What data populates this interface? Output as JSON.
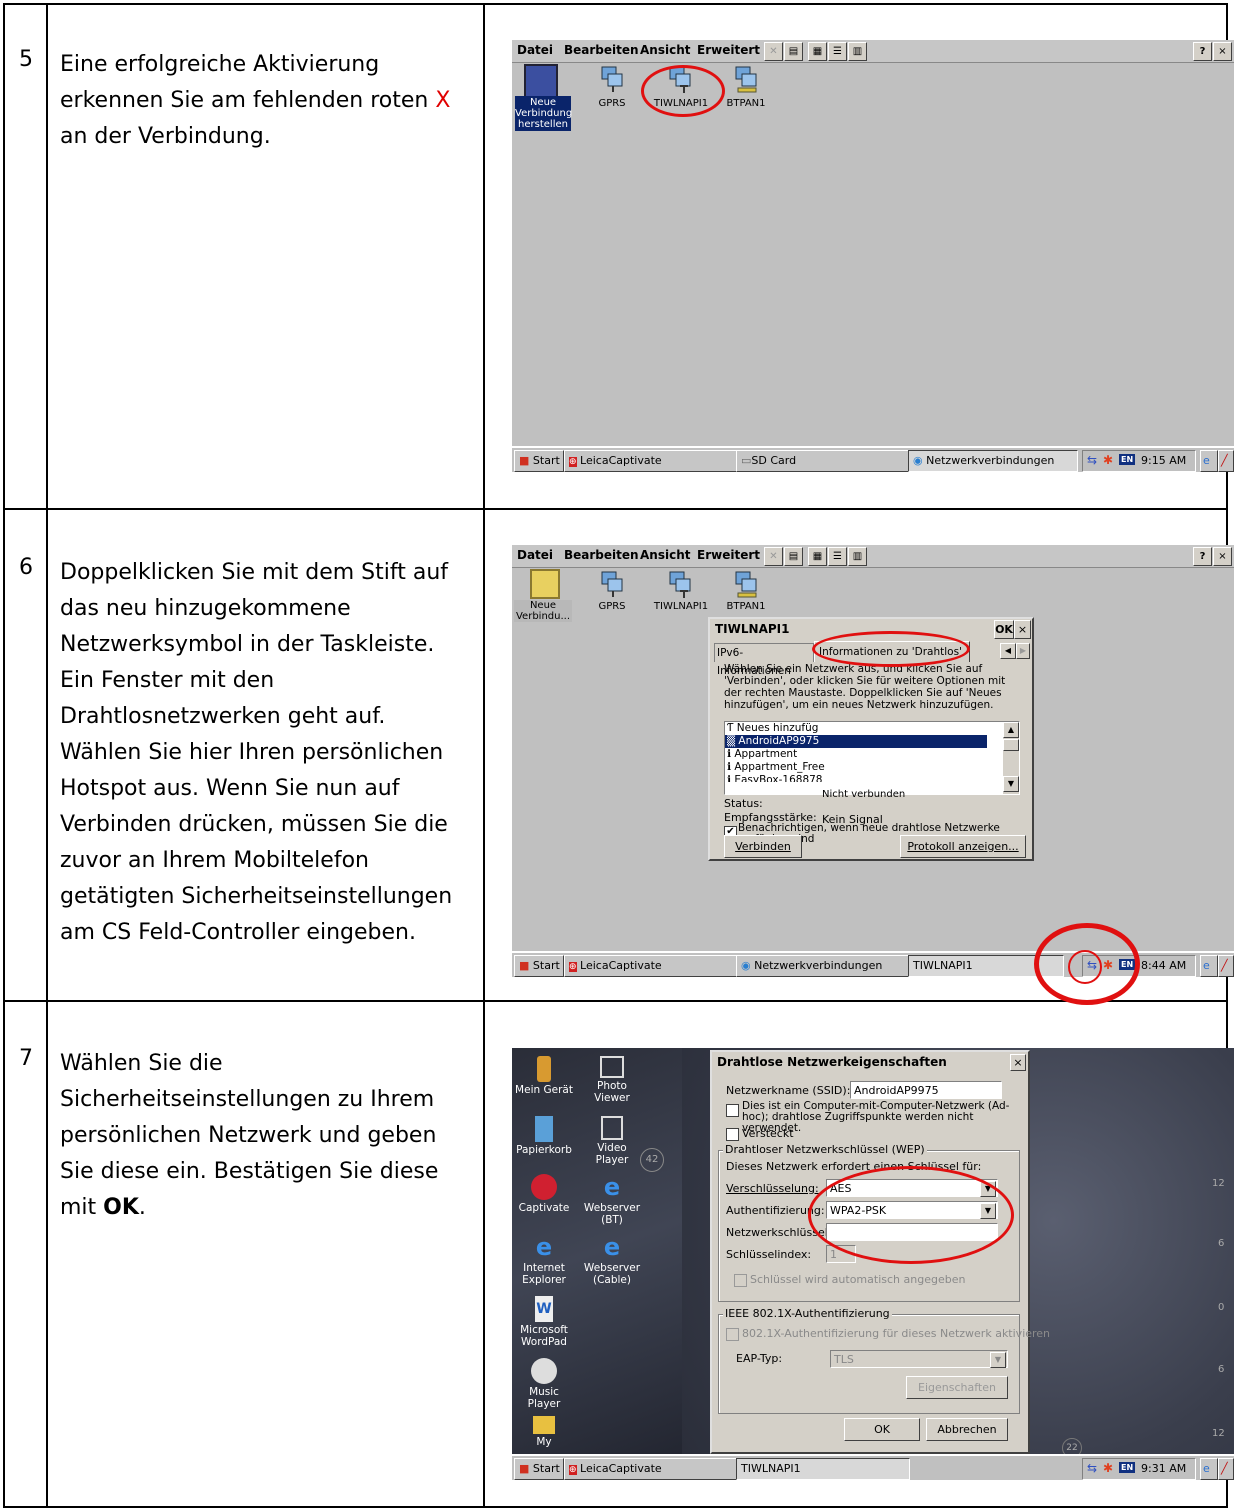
{
  "steps": [
    {
      "number": "5",
      "text_before": "Eine erfolgreiche Aktivierung erkennen Sie am fehlenden roten ",
      "text_highlight": "X",
      "text_after": " an der Verbindung.",
      "screenshot": {
        "menu": [
          "Datei",
          "Bearbeiten",
          "Ansicht",
          "Erweitert"
        ],
        "help": "?",
        "close": "×",
        "icons": [
          {
            "label": "Neue Verbindung herstellen",
            "selected": true
          },
          {
            "label": "GPRS"
          },
          {
            "label": "TIWLNAPI1"
          },
          {
            "label": "BTPAN1"
          }
        ],
        "taskbar": {
          "start": "Start",
          "buttons": [
            "LeicaCaptivate",
            "SD Card",
            "Netzwerkverbindungen"
          ],
          "clock": "9:15 AM",
          "lang": "EN"
        }
      }
    },
    {
      "number": "6",
      "text": "Doppelklicken Sie mit dem Stift auf das neu hinzugekommene Netzwerksymbol in der Taskleiste. Ein Fenster mit den Drahtlosnetzwerken geht auf. Wählen Sie hier Ihren persönlichen Hotspot aus. Wenn Sie nun auf Verbinden drücken, müssen Sie die zuvor an Ihrem Mobiltelefon getätigten Sicherheitseinstellungen am CS Feld-Controller eingeben.",
      "screenshot": {
        "menu": [
          "Datei",
          "Bearbeiten",
          "Ansicht",
          "Erweitert"
        ],
        "help": "?",
        "close": "×",
        "icons": [
          {
            "label": "Neue Verbindu..."
          },
          {
            "label": "GPRS"
          },
          {
            "label": "TIWLNAPI1"
          },
          {
            "label": "BTPAN1"
          }
        ],
        "dialog": {
          "title": "TIWLNAPI1",
          "ok": "OK",
          "close": "×",
          "tabs": [
            "IPv6-Informationen",
            "Informationen zu 'Drahtlos'"
          ],
          "instructions": "Wählen Sie ein Netzwerk aus, und klicken Sie auf 'Verbinden', oder klicken Sie für weitere Optionen mit der rechten Maustaste. Doppelklicken Sie auf 'Neues hinzufügen', um ein neues Netzwerk hinzuzufügen.",
          "networks": [
            "Neues hinzufüg",
            "AndroidAP9975",
            "Appartment",
            "Appartment_Free",
            "EasyBox-168878"
          ],
          "selected_network": "AndroidAP9975",
          "overlap_text": "Nicht verbunden",
          "status_label": "Status:",
          "signal_label": "Empfangsstärke:",
          "signal_value": "Kein Signal",
          "notify_text": "Benachrichtigen, wenn neue drahtlose Netzwerke verfügbar sind",
          "connect": "Verbinden",
          "log": "Protokoll anzeigen..."
        },
        "taskbar": {
          "start": "Start",
          "buttons": [
            "LeicaCaptivate",
            "Netzwerkverbindungen",
            "TIWLNAPI1"
          ],
          "clock": "8:44 AM",
          "lang": "EN"
        }
      }
    },
    {
      "number": "7",
      "text_before": "Wählen Sie die Sicherheitseinstellungen zu Ihrem persönlichen Netzwerk und geben Sie diese ein. Bestätigen Sie diese mit ",
      "text_bold": "OK",
      "text_after": ".",
      "screenshot": {
        "desktop_icons": [
          "Mein Gerät",
          "Photo Viewer",
          "Papierkorb",
          "Video Player",
          "Captivate",
          "Webserver (BT)",
          "Internet Explorer",
          "Webserver (Cable)",
          "Microsoft WordPad",
          "Music Player",
          "My"
        ],
        "dial_numbers": [
          "42",
          "12",
          "6",
          "0",
          "6",
          "12",
          "22"
        ],
        "dialog": {
          "title": "Drahtlose Netzwerkeigenschaften",
          "close": "×",
          "ssid_label": "Netzwerkname (SSID):",
          "ssid_value": "AndroidAP9975",
          "adhoc_text": "Dies ist ein Computer-mit-Computer-Netzwerk (Ad-hoc); drahtlose Zugriffspunkte werden nicht verwendet.",
          "hidden_text": "Versteckt",
          "wep_group": "Drahtloser Netzwerkschlüssel (WEP)",
          "requires_text": "Dieses Netzwerk erfordert einen Schlüssel für:",
          "encryption_label": "Verschlüsselung:",
          "encryption_value": "AES",
          "auth_label": "Authentifizierung:",
          "auth_value": "WPA2-PSK",
          "key_label": "Netzwerkschlüssel:",
          "index_label": "Schlüsselindex:",
          "index_value": "1",
          "auto_key_text": "Schlüssel wird automatisch angegeben",
          "ieee_group": "IEEE 802.1X-Authentifizierung",
          "ieee_text": "802.1X-Authentifizierung für dieses Netzwerk aktivieren",
          "eap_label": "EAP-Typ:",
          "eap_value": "TLS",
          "properties": "Eigenschaften",
          "ok": "OK",
          "cancel": "Abbrechen"
        },
        "taskbar": {
          "start": "Start",
          "buttons": [
            "LeicaCaptivate",
            "TIWLNAPI1"
          ],
          "clock": "9:31 AM",
          "lang": "EN"
        }
      }
    }
  ]
}
